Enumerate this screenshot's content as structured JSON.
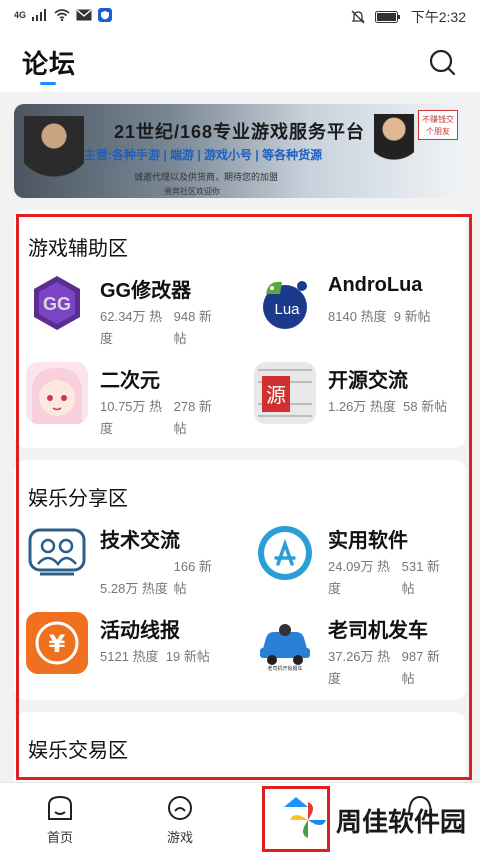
{
  "status_bar": {
    "network": "4G",
    "time": "下午2:32"
  },
  "header": {
    "title": "论坛"
  },
  "banner": {
    "headline": "21世纪/168专业游戏服务平台",
    "subline": "主营:各种手游 | 端游 | 游戏小号 | 等各种货源",
    "line3": "诚邀代理以及供货商，期待您的加盟",
    "line4": "贵宾社区欢迎你",
    "badge": "不赚钱交个朋友"
  },
  "sections": [
    {
      "title": "游戏辅助区",
      "items": [
        {
          "name": "GG修改器",
          "heat": "62.34万 热度",
          "posts": "948 新帖",
          "icon": "gg-modifier-icon"
        },
        {
          "name": "AndroLua",
          "heat": "8140 热度",
          "posts": "9 新帖",
          "icon": "androlua-icon"
        },
        {
          "name": "二次元",
          "heat": "10.75万 热度",
          "posts": "278 新帖",
          "icon": "anime-girl-icon"
        },
        {
          "name": "开源交流",
          "heat": "1.26万 热度",
          "posts": "58 新帖",
          "icon": "open-source-icon"
        }
      ]
    },
    {
      "title": "娱乐分享区",
      "items": [
        {
          "name": "技术交流",
          "heat": "5.28万 热度",
          "posts": "166 新帖",
          "icon": "people-icon"
        },
        {
          "name": "实用软件",
          "heat": "24.09万 热度",
          "posts": "531 新帖",
          "icon": "app-store-icon"
        },
        {
          "name": "活动线报",
          "heat": "5121 热度",
          "posts": "19 新帖",
          "icon": "yen-icon"
        },
        {
          "name": "老司机发车",
          "heat": "37.26万 热度",
          "posts": "987 新帖",
          "icon": "car-icon"
        }
      ]
    },
    {
      "title": "娱乐交易区"
    }
  ],
  "tabs": [
    {
      "label": "首页",
      "icon": "home-icon"
    },
    {
      "label": "游戏",
      "icon": "game-icon"
    },
    {
      "label": "",
      "icon": "forum-icon"
    },
    {
      "label": "",
      "icon": "profile-icon"
    }
  ],
  "watermark": "周佳软件园"
}
